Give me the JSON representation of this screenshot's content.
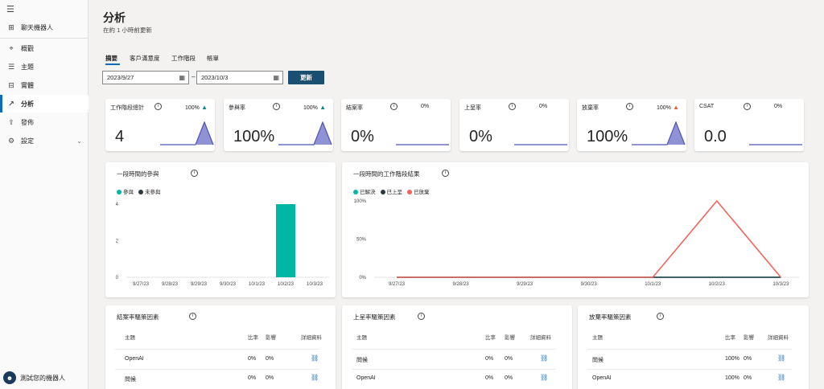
{
  "sidebar": {
    "chatbot": "聊天機器人",
    "items": [
      {
        "label": "概觀",
        "icon": "overview-icon"
      },
      {
        "label": "主題",
        "icon": "topics-icon"
      },
      {
        "label": "實體",
        "icon": "entities-icon"
      },
      {
        "label": "分析",
        "icon": "analytics-icon"
      },
      {
        "label": "發佈",
        "icon": "publish-icon"
      },
      {
        "label": "設定",
        "icon": "settings-icon"
      }
    ],
    "test_bot": "測試您的機器人"
  },
  "header": {
    "title": "分析",
    "subtitle": "在約 1 小時前更新"
  },
  "tabs": [
    "摘要",
    "客戶滿意度",
    "工作階段",
    "帳單"
  ],
  "filters": {
    "start_date": "2023/9/27",
    "end_date": "2023/10/3",
    "dash": "–",
    "refresh": "更新"
  },
  "kpis": [
    {
      "label": "工作階段總計",
      "value": "4",
      "change": "100%",
      "trend": "up",
      "trend_color": "#0b8a8a",
      "spark": [
        0,
        0,
        0,
        0,
        0,
        1,
        0
      ]
    },
    {
      "label": "參與率",
      "value": "100%",
      "change": "100%",
      "trend": "up",
      "trend_color": "#0b8a8a",
      "spark": [
        0,
        0,
        0,
        0,
        0,
        1,
        0
      ]
    },
    {
      "label": "結案率",
      "value": "0%",
      "change": "0%",
      "trend": "flat",
      "spark": [
        0,
        0,
        0,
        0,
        0,
        0,
        0
      ]
    },
    {
      "label": "上呈率",
      "value": "0%",
      "change": "0%",
      "trend": "flat",
      "spark": [
        0,
        0,
        0,
        0,
        0,
        0,
        0
      ]
    },
    {
      "label": "放棄率",
      "value": "100%",
      "change": "100%",
      "trend": "up",
      "trend_color": "#d9623f",
      "spark": [
        0,
        0,
        0,
        0,
        0,
        1,
        0
      ]
    },
    {
      "label": "CSAT",
      "value": "0.0",
      "change": "0%",
      "trend": "flat",
      "spark": [
        0,
        0,
        0,
        0,
        0,
        0,
        0
      ]
    }
  ],
  "chart_data": [
    {
      "type": "bar",
      "title": "一段時間的參與",
      "categories": [
        "9/27/23",
        "9/28/23",
        "9/29/23",
        "9/30/23",
        "10/1/23",
        "10/2/23",
        "10/3/23"
      ],
      "series": [
        {
          "name": "參與",
          "color": "#00b7a6",
          "values": [
            0,
            0,
            0,
            0,
            0,
            4,
            0
          ]
        },
        {
          "name": "未參與",
          "color": "#2b3a42",
          "values": [
            0,
            0,
            0,
            0,
            0,
            0,
            0
          ]
        }
      ],
      "yticks": [
        "4",
        "2",
        "0"
      ],
      "ylim": [
        0,
        4
      ],
      "legend": "top-left"
    },
    {
      "type": "line",
      "title": "一段時間的工作階段結果",
      "categories": [
        "9/27/23",
        "9/28/23",
        "9/29/23",
        "9/30/23",
        "10/1/23",
        "10/2/23",
        "10/3/23"
      ],
      "series": [
        {
          "name": "已解決",
          "color": "#00b7a6",
          "values": [
            0,
            0,
            0,
            0,
            0,
            0,
            0
          ]
        },
        {
          "name": "已上呈",
          "color": "#2b3a42",
          "values": [
            0,
            0,
            0,
            0,
            0,
            0,
            0
          ]
        },
        {
          "name": "已放棄",
          "color": "#f0645a",
          "values": [
            0,
            0,
            0,
            0,
            0,
            100,
            0
          ]
        }
      ],
      "yticks": [
        "100%",
        "50%",
        "0%"
      ],
      "ylim": [
        0,
        100
      ],
      "legend": "top-left"
    }
  ],
  "tables": [
    {
      "title": "結案率驅策因素",
      "headers": [
        "主題",
        "比率",
        "影響",
        "詳細資料"
      ],
      "rows": [
        [
          "OpenAI",
          "0%",
          "0%"
        ],
        [
          "問候",
          "0%",
          "0%"
        ]
      ]
    },
    {
      "title": "上呈率驅策因素",
      "headers": [
        "主題",
        "比率",
        "影響",
        "詳細資料"
      ],
      "rows": [
        [
          "問候",
          "0%",
          "0%"
        ],
        [
          "OpenAI",
          "0%",
          "0%"
        ]
      ]
    },
    {
      "title": "放棄率驅策因素",
      "headers": [
        "主題",
        "比率",
        "影響",
        "詳細資料"
      ],
      "rows": [
        [
          "問候",
          "100%",
          "0%"
        ],
        [
          "OpenAI",
          "100%",
          "0%"
        ]
      ]
    }
  ]
}
